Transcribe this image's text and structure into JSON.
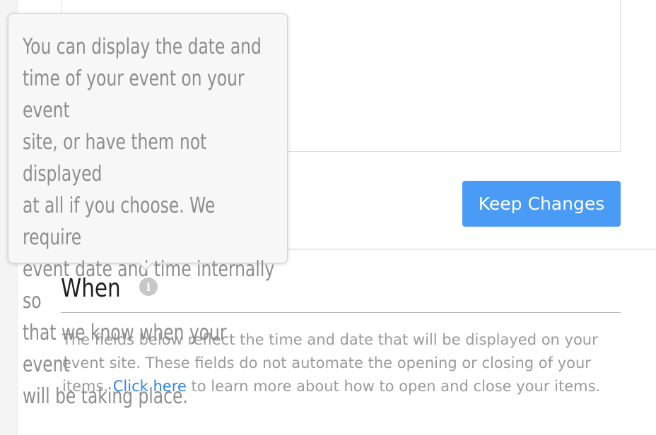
{
  "form": {
    "keep_changes_label": "Keep Changes"
  },
  "when_section": {
    "heading": "When",
    "info_icon_glyph": "i",
    "description_before_link": "The fields below reflect the time and date that will be displayed on your event site. These fields do not automate the opening or closing of your items. ",
    "link_text": "Click here",
    "description_after_link": " to learn more about how to open and close your items."
  },
  "tooltip": {
    "lines": [
      "You can display the date and",
      "time of your event on your event",
      "site, or have them not displayed",
      "at all if you choose. We require",
      "event date and time internally so",
      "that we know when your event",
      "will be taking place."
    ]
  },
  "colors": {
    "primary_button": "#4a9bf5",
    "link": "#2f86e6",
    "muted_text": "#9a9a9a"
  }
}
